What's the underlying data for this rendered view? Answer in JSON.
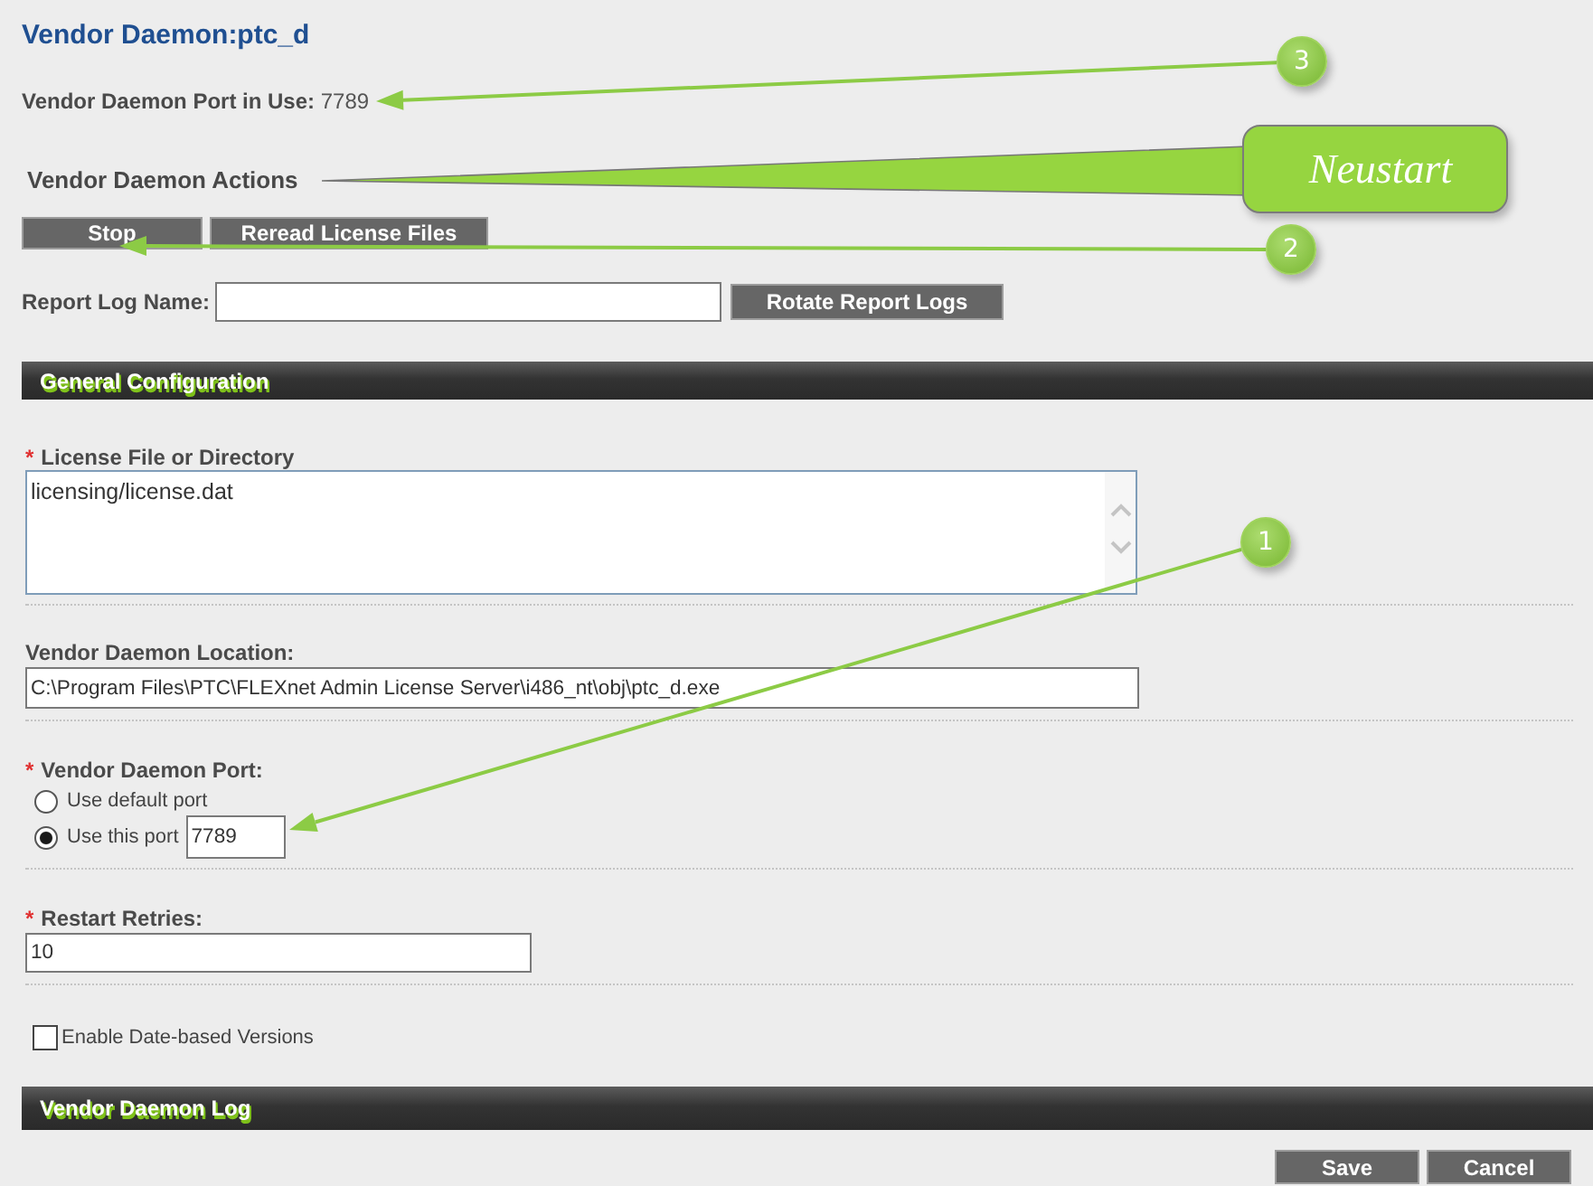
{
  "title": "Vendor Daemon:ptc_d",
  "port_in_use": {
    "label": "Vendor Daemon Port in Use:",
    "value": "7789"
  },
  "actions": {
    "heading": "Vendor Daemon Actions",
    "buttons": [
      "Stop",
      "Reread License Files"
    ]
  },
  "report_log": {
    "label": "Report Log Name:",
    "button": "Rotate Report Logs"
  },
  "general_configuration": {
    "heading": "General Configuration",
    "fields": [
      {
        "kind": "textarea",
        "required_mark": "*",
        "label": "License File or Directory",
        "value": "licensing/license.dat"
      },
      {
        "kind": "text",
        "label": "Vendor Daemon Location:",
        "value": "C:\\Program Files\\PTC\\FLEXnet Admin License Server\\i486_nt\\obj\\ptc_d.exe"
      },
      {
        "kind": "radio",
        "required_mark": "*",
        "label": "Vendor Daemon Port:",
        "options": [
          {
            "label": "Use default port",
            "selected": false
          },
          {
            "label": "Use this port",
            "selected": true,
            "value": "7789"
          }
        ]
      },
      {
        "kind": "text",
        "required_mark": "*",
        "label": "Restart Retries:",
        "value": "10"
      },
      {
        "kind": "checkbox",
        "label": "Enable Date-based Versions",
        "checked": false
      }
    ]
  },
  "vendor_daemon_log": {
    "heading": "Vendor Daemon Log"
  },
  "footer_buttons": [
    "Save",
    "Cancel"
  ],
  "annotations": [
    {
      "kind": "number",
      "label": "3"
    },
    {
      "kind": "callout",
      "text": "Neustart"
    },
    {
      "kind": "number",
      "label": "2"
    },
    {
      "kind": "number",
      "label": "1"
    }
  ]
}
